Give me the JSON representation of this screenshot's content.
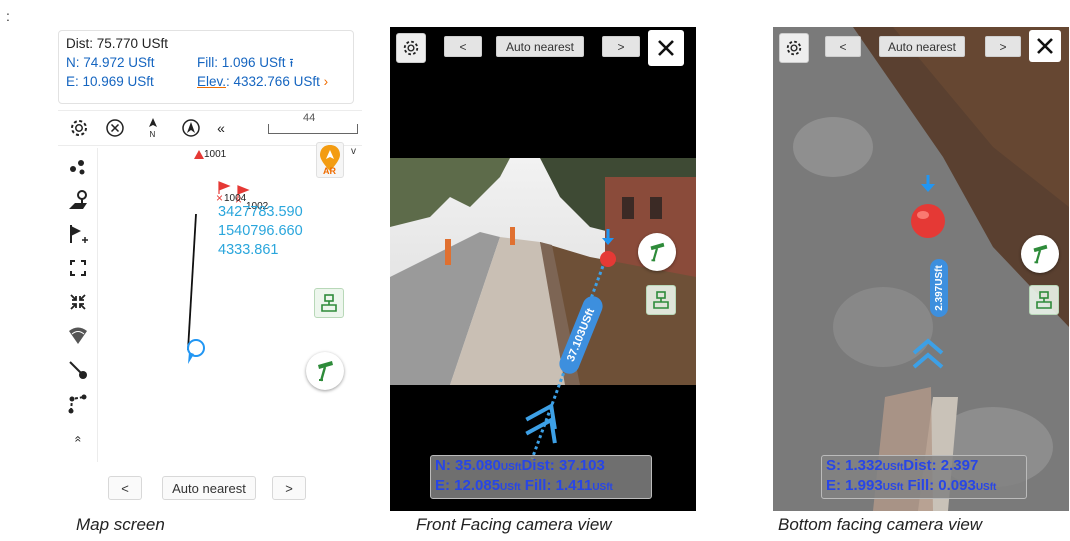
{
  "prefix": ":",
  "map": {
    "dist": "Dist: 75.770 USft",
    "n": "N: 74.972 USft",
    "e": "E: 10.969 USft",
    "fill": "Fill: 1.096 USft",
    "elev_label": "Elev.",
    "elev_value": ": 4332.766 USft",
    "scale": "44",
    "toolbar_collapse": "«",
    "more_up": "«",
    "points": [
      "1001",
      "1004",
      "1002"
    ],
    "coord_lines": [
      "3427783.590",
      "1540796.660",
      "4333.861"
    ],
    "ar_label": "AR",
    "ar_suffix": "v",
    "nav_prev": "<",
    "nav_mode": "Auto nearest",
    "nav_next": ">"
  },
  "front_camera": {
    "nav_prev": "<",
    "nav_mode": "Auto nearest",
    "nav_next": ">",
    "tape_label": "37.103USft",
    "hud_n": "N: 35.080",
    "hud_n_unit": "USft",
    "hud_dist": "Dist: 37.103",
    "hud_e": "E: 12.085",
    "hud_e_unit": "USft",
    "hud_fill": "Fill: 1.411",
    "hud_fill_unit": "USft"
  },
  "bottom_camera": {
    "nav_prev": "<",
    "nav_mode": "Auto nearest",
    "nav_next": ">",
    "tape_label": "2.397USft",
    "hud_s": "S: 1.332",
    "hud_s_unit": "USft",
    "hud_dist": "Dist: 2.397",
    "hud_e": "E: 1.993",
    "hud_e_unit": "USft",
    "hud_fill": "Fill: 0.093",
    "hud_fill_unit": "USft"
  },
  "captions": [
    "Map screen",
    "Front Facing camera view",
    "Bottom facing camera view"
  ],
  "colors": {
    "accent_blue": "#1565c0",
    "coords": "#2aa6dc",
    "hud_text": "#2846e6",
    "stake_green": "#2e8b3a",
    "ar_orange": "#f39c12",
    "point_red": "#e53935"
  },
  "icons": [
    "gear-icon",
    "close-icon",
    "compass-icon",
    "north-icon",
    "navigate-icon",
    "points-icon",
    "map-pin-icon",
    "add-flag-icon",
    "expand-icon",
    "collapse-icon",
    "wifi-icon",
    "line-icon",
    "polyline-icon",
    "stake-icon",
    "level-icon"
  ]
}
